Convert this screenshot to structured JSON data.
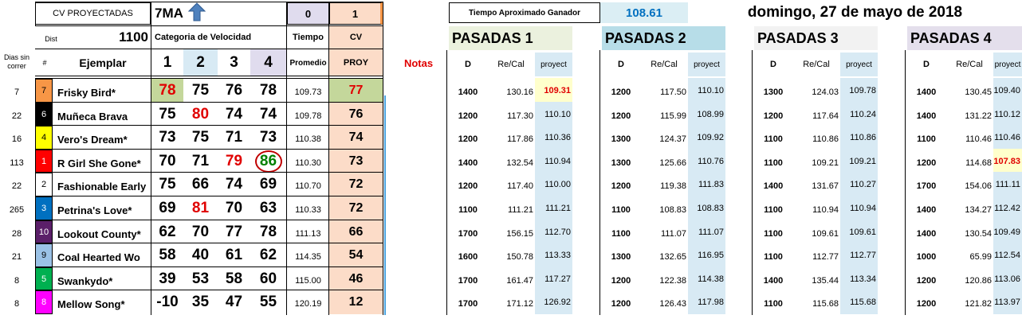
{
  "top": {
    "title": "CV PROYECTADAS",
    "race": "7MA",
    "counter_left": "0",
    "counter_right": "1",
    "tiempo_label": "Tiempo Aproximado Ganador",
    "tiempo_value": "108.61",
    "date": "domingo, 27 de mayo de 2018"
  },
  "header": {
    "dist_label": "Dist",
    "dist_value": "1100",
    "categoria": "Categoria de Velocidad",
    "tiempo": "Tiempo",
    "cv": "CV",
    "dias": "Dias sin correr",
    "num": "#",
    "ejemplar": "Ejemplar",
    "cat1": "1",
    "cat2": "2",
    "cat3": "3",
    "cat4": "4",
    "promedio": "Promedio",
    "proy": "PROY",
    "notas": "Notas"
  },
  "pasadas": {
    "titles": [
      "PASADAS 1",
      "PASADAS 2",
      "PASADAS 3",
      "PASADAS 4"
    ],
    "sub": {
      "d": "D",
      "recal": "Re/Cal",
      "proyect": "proyect"
    }
  },
  "colors": {
    "arrow": "#4f81bd",
    "red": "#e00000",
    "green": "#008000"
  },
  "rows": [
    {
      "dias": "7",
      "num": "7",
      "num_bg": "#f79646",
      "num_fg": "#000000",
      "name": "Frisky Bird*",
      "c1": "78",
      "c2": "75",
      "c3": "76",
      "c4": "78",
      "prom": "109.73",
      "proy": "77",
      "p": [
        [
          "1400",
          "130.16",
          "109.31"
        ],
        [
          "1200",
          "117.50",
          "110.10"
        ],
        [
          "1300",
          "124.03",
          "109.78"
        ],
        [
          "1400",
          "130.45",
          "109.40"
        ]
      ]
    },
    {
      "dias": "22",
      "num": "6",
      "num_bg": "#000000",
      "num_fg": "#ffffff",
      "name": "Muñeca Brava",
      "c1": "75",
      "c2": "80",
      "c3": "74",
      "c4": "74",
      "prom": "109.78",
      "proy": "76",
      "p": [
        [
          "1200",
          "117.30",
          "110.10"
        ],
        [
          "1200",
          "115.99",
          "108.99"
        ],
        [
          "1200",
          "117.64",
          "110.24"
        ],
        [
          "1400",
          "131.22",
          "110.12"
        ]
      ]
    },
    {
      "dias": "16",
      "num": "4",
      "num_bg": "#ffff00",
      "num_fg": "#000000",
      "name": "Vero's Dream*",
      "c1": "73",
      "c2": "75",
      "c3": "71",
      "c4": "73",
      "prom": "110.38",
      "proy": "74",
      "p": [
        [
          "1200",
          "117.86",
          "110.36"
        ],
        [
          "1300",
          "124.37",
          "109.92"
        ],
        [
          "1100",
          "110.86",
          "110.86"
        ],
        [
          "1100",
          "110.46",
          "110.46"
        ]
      ]
    },
    {
      "dias": "113",
      "num": "1",
      "num_bg": "#ff0000",
      "num_fg": "#ffffff",
      "name": "R Girl She Gone*",
      "c1": "70",
      "c2": "71",
      "c3": "79",
      "c4": "86",
      "prom": "110.30",
      "proy": "73",
      "p": [
        [
          "1400",
          "132.54",
          "110.94"
        ],
        [
          "1300",
          "125.66",
          "110.76"
        ],
        [
          "1100",
          "109.21",
          "109.21"
        ],
        [
          "1200",
          "114.68",
          "107.83"
        ]
      ]
    },
    {
      "dias": "22",
      "num": "2",
      "num_bg": "#ffffff",
      "num_fg": "#000000",
      "name": "Fashionable Early",
      "c1": "75",
      "c2": "66",
      "c3": "74",
      "c4": "69",
      "prom": "110.70",
      "proy": "72",
      "p": [
        [
          "1200",
          "117.40",
          "110.00"
        ],
        [
          "1200",
          "119.38",
          "111.83"
        ],
        [
          "1400",
          "131.67",
          "110.27"
        ],
        [
          "1700",
          "154.06",
          "111.11"
        ]
      ]
    },
    {
      "dias": "265",
      "num": "3",
      "num_bg": "#0070c0",
      "num_fg": "#ffffff",
      "name": "Petrina's Love*",
      "c1": "69",
      "c2": "81",
      "c3": "70",
      "c4": "63",
      "prom": "110.33",
      "proy": "72",
      "p": [
        [
          "1100",
          "111.21",
          "111.21"
        ],
        [
          "1100",
          "108.83",
          "108.83"
        ],
        [
          "1100",
          "110.94",
          "110.94"
        ],
        [
          "1400",
          "134.27",
          "112.42"
        ]
      ]
    },
    {
      "dias": "28",
      "num": "10",
      "num_bg": "#5b1f69",
      "num_fg": "#ffffff",
      "name": "Lookout County*",
      "c1": "62",
      "c2": "70",
      "c3": "77",
      "c4": "78",
      "prom": "111.13",
      "proy": "66",
      "p": [
        [
          "1700",
          "156.15",
          "112.70"
        ],
        [
          "1100",
          "111.07",
          "111.07"
        ],
        [
          "1100",
          "109.61",
          "109.61"
        ],
        [
          "1400",
          "130.54",
          "109.49"
        ]
      ]
    },
    {
      "dias": "21",
      "num": "9",
      "num_bg": "#9bc2e6",
      "num_fg": "#000000",
      "name": "Coal Hearted Wo",
      "c1": "58",
      "c2": "40",
      "c3": "61",
      "c4": "62",
      "prom": "114.35",
      "proy": "54",
      "p": [
        [
          "1600",
          "150.78",
          "113.33"
        ],
        [
          "1300",
          "132.65",
          "116.95"
        ],
        [
          "1100",
          "112.77",
          "112.77"
        ],
        [
          "1000",
          "65.99",
          "112.54"
        ]
      ]
    },
    {
      "dias": "8",
      "num": "5",
      "num_bg": "#00b050",
      "num_fg": "#ffffff",
      "name": "Swankydo*",
      "c1": "39",
      "c2": "53",
      "c3": "58",
      "c4": "60",
      "prom": "115.00",
      "proy": "46",
      "p": [
        [
          "1700",
          "161.47",
          "117.27"
        ],
        [
          "1200",
          "122.38",
          "114.38"
        ],
        [
          "1400",
          "135.44",
          "113.34"
        ],
        [
          "1200",
          "120.86",
          "113.06"
        ]
      ]
    },
    {
      "dias": "8",
      "num": "8",
      "num_bg": "#ff00ff",
      "num_fg": "#ffffff",
      "name": "Mellow Song*",
      "c1": "-10",
      "c2": "35",
      "c3": "47",
      "c4": "55",
      "prom": "120.19",
      "proy": "12",
      "p": [
        [
          "1700",
          "171.12",
          "126.92"
        ],
        [
          "1200",
          "126.43",
          "117.98"
        ],
        [
          "1100",
          "115.68",
          "115.68"
        ],
        [
          "1200",
          "121.82",
          "113.97"
        ]
      ]
    }
  ]
}
